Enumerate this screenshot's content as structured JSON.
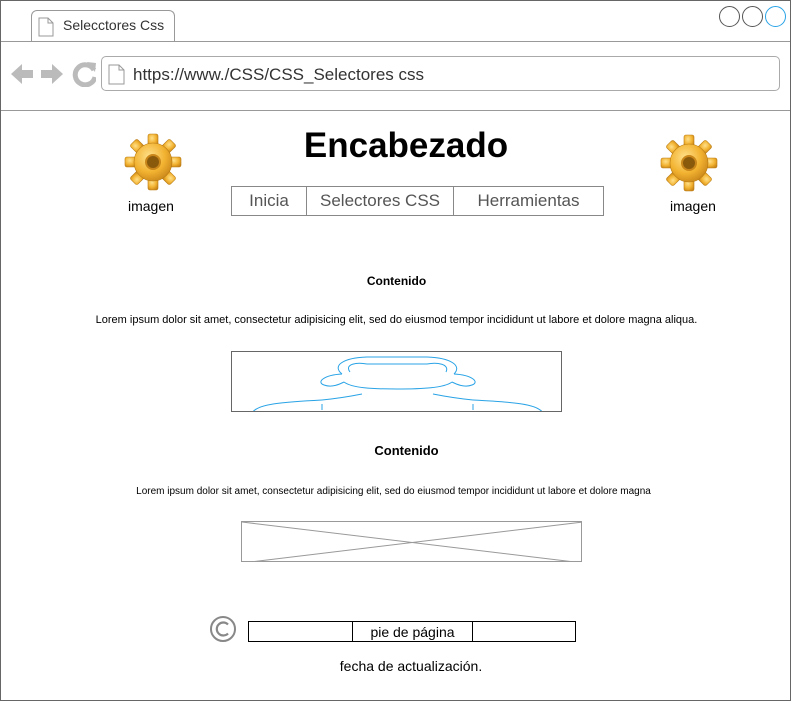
{
  "browser": {
    "tab_title": "Selecctores Css",
    "url": "https://www./CSS/CSS_Selectores css"
  },
  "header": {
    "title": "Encabezado",
    "left_image_label": "imagen",
    "right_image_label": "imagen",
    "menu": [
      "Inicia",
      "Selectores CSS",
      "Herramientas"
    ]
  },
  "content": {
    "section1_title": "Contenido",
    "section1_text": "Lorem ipsum dolor sit amet, consectetur adipisicing elit, sed do eiusmod tempor incididunt ut labore et dolore magna aliqua.",
    "section2_title": "Contenido",
    "section2_text": "Lorem ipsum dolor sit amet, consectetur adipisicing elit, sed do eiusmod tempor incididunt ut labore et dolore magna"
  },
  "footer": {
    "label": "pie de página",
    "updated": "fecha de actualización."
  },
  "icons": {
    "page": "page-icon",
    "back": "back-arrow-icon",
    "forward": "forward-arrow-icon",
    "reload": "reload-icon",
    "gear": "gear-icon",
    "copyright": "copyright-icon"
  },
  "colors": {
    "accent": "#29a3e6",
    "gear": "#f2b230"
  }
}
